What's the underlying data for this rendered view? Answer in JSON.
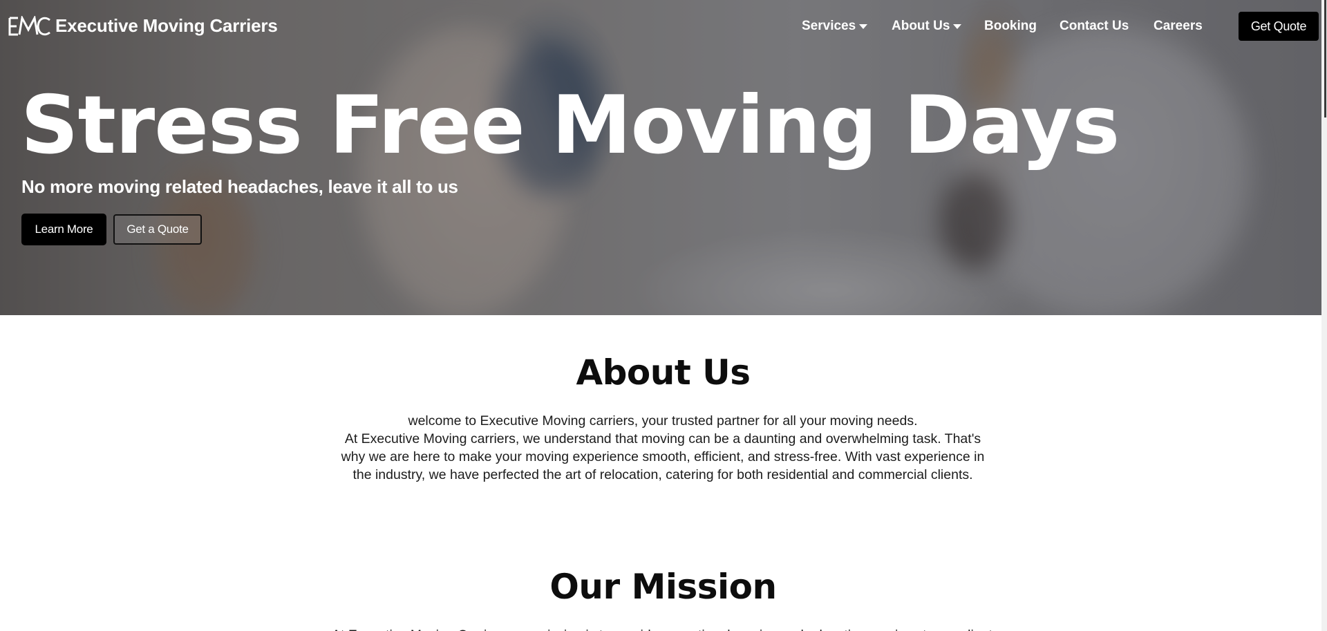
{
  "brand": {
    "logo_mark": "EMC",
    "name": "Executive Moving Carriers"
  },
  "nav": {
    "items": [
      {
        "label": "Services",
        "dropdown": true
      },
      {
        "label": "About Us",
        "dropdown": true
      },
      {
        "label": "Booking",
        "dropdown": false
      },
      {
        "label": "Contact Us",
        "dropdown": false
      },
      {
        "label": "Careers",
        "dropdown": false
      }
    ],
    "cta_label": "Get Quote"
  },
  "hero": {
    "title": "Stress Free Moving Days",
    "subtitle": "No more moving related headaches, leave it all to us",
    "primary_button": "Learn More",
    "secondary_button": "Get a Quote"
  },
  "about": {
    "title": "About Us",
    "paragraph_1": "welcome to Executive Moving carriers, your trusted partner for all your moving needs.",
    "paragraph_2": "At Executive Moving carriers, we understand that moving can be a daunting and overwhelming task. That's why we are here to make your moving experience smooth, efficient, and stress-free. With vast experience in the industry, we have perfected the art of relocation, catering for both residential and commercial clients."
  },
  "mission": {
    "title": "Our Mission",
    "peek_text": "At Executive Moving Carriers, our mission is to provide exceptional moving and relocation services to our clients."
  },
  "colors": {
    "button_dark": "#000000",
    "text_light": "#ffffff",
    "heading_dark": "#0d0d0d"
  },
  "icons": {
    "dropdown": "caret-down-icon",
    "logo": "emc-logo-icon"
  }
}
